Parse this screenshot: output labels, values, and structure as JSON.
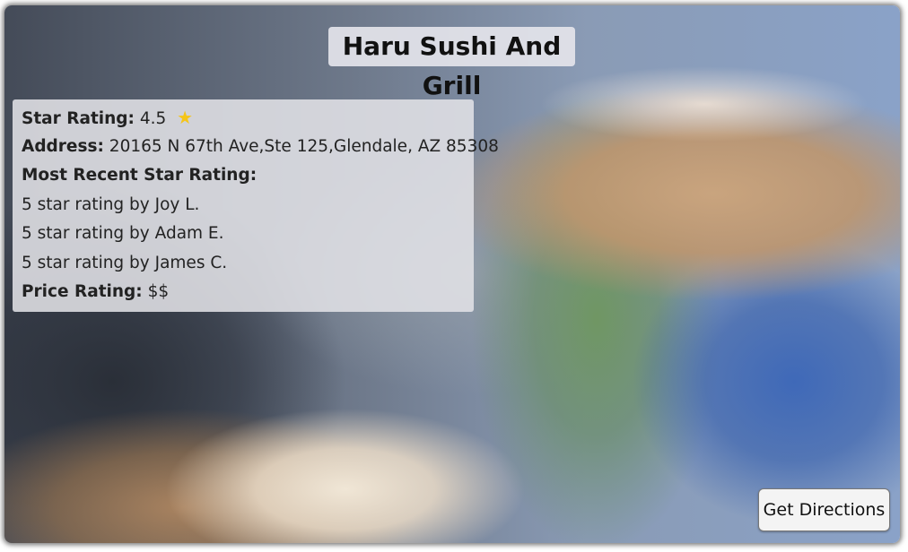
{
  "restaurant": {
    "name": "Haru Sushi And Grill"
  },
  "info": {
    "star_rating_label": "Star Rating:",
    "star_rating_value": "4.5",
    "star_icon": "star-icon",
    "address_label": "Address:",
    "address_value": "20165 N 67th Ave,Ste 125,Glendale, AZ 85308",
    "recent_label": "Most Recent Star Rating:",
    "recent_ratings": [
      "5 star rating by Joy L.",
      "5 star rating by Adam E.",
      "5 star rating by James C."
    ],
    "price_label": "Price Rating:",
    "price_value": "$$"
  },
  "actions": {
    "directions_label": "Get Directions"
  },
  "colors": {
    "star": "#f5c518",
    "panel": "#e1e1e6"
  }
}
